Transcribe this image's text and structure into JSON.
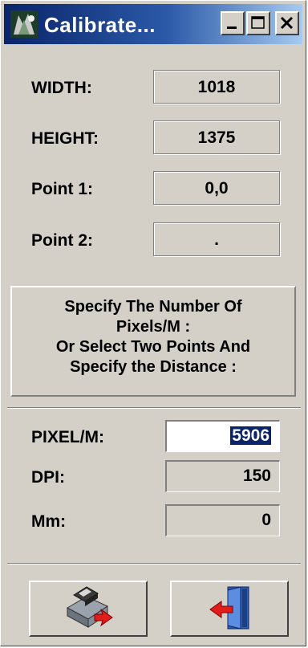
{
  "window": {
    "title": "Calibrate...",
    "controls": {
      "minimize": "_",
      "maximize": "□",
      "close": "×"
    }
  },
  "info": {
    "width_label": "WIDTH:",
    "width_value": "1018",
    "height_label": "HEIGHT:",
    "height_value": "1375",
    "point1_label": "Point 1:",
    "point1_value": "0,0",
    "point2_label": "Point 2:",
    "point2_value": "."
  },
  "instructions": {
    "line1": "Specify The Number Of",
    "line2": "Pixels/M :",
    "line3": "Or Select Two Points And",
    "line4": "Specify the Distance :"
  },
  "inputs": {
    "pixel_label": "PIXEL/M:",
    "pixel_value": "5906",
    "dpi_label": "DPI:",
    "dpi_value": "150",
    "mm_label": "Mm:",
    "mm_value": "0"
  },
  "buttons": {
    "save_icon": "floppy-disk-save-icon",
    "exit_icon": "door-exit-icon"
  },
  "colors": {
    "window_bg": "#d4d0c8",
    "title_start": "#0a246a",
    "title_end": "#a6caf0",
    "selection": "#0a246a",
    "arrow_red": "#e21b1b"
  }
}
